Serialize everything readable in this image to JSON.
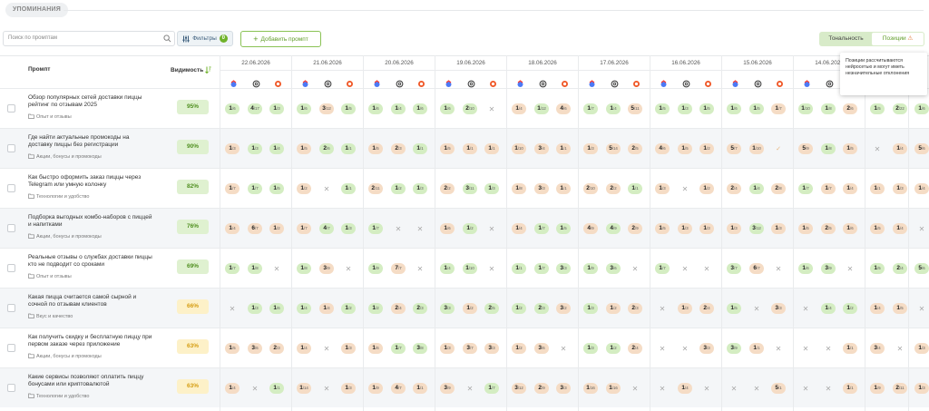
{
  "section": {
    "title": "УПОМИНАНИЯ"
  },
  "search": {
    "placeholder": "Поиск по промптам"
  },
  "filters": {
    "label": "Фильтры",
    "count": "0"
  },
  "add_prompt": {
    "label": "Добавить промпт"
  },
  "toggle": {
    "tonality": "Тональность",
    "positions": "Позиции"
  },
  "tooltip": {
    "text": "Позиции рассчитываются нейросетью и могут иметь незначительные отклонения"
  },
  "table": {
    "col_prompt": "Промпт",
    "col_visibility": "Видимость",
    "dates": [
      "22.06.2026",
      "21.06.2026",
      "20.06.2026",
      "19.06.2026",
      "18.06.2026",
      "17.06.2026",
      "16.06.2026",
      "15.06.2026",
      "14.06.2026"
    ],
    "engines": [
      "yandex-icon",
      "chatgpt-icon",
      "perplexity-icon"
    ],
    "rows": [
      {
        "title": "Обзор популярных сетей доставки пиццы рейтинг по отзывам 2025",
        "category": "Опыт и отзывы",
        "visibility": "95%",
        "tone": "high",
        "cells": [
          [
            "1",
            "/6",
            "g"
          ],
          [
            "4",
            "/17",
            "g"
          ],
          [
            "1",
            "/3",
            "g"
          ],
          [
            "1",
            "/6",
            "g"
          ],
          [
            "3",
            "/12",
            "o"
          ],
          [
            "1",
            "/5",
            "g"
          ],
          [
            "1",
            "/6",
            "g"
          ],
          [
            "1",
            "/4",
            "g"
          ],
          [
            "1",
            "/6",
            "g"
          ],
          [
            "1",
            "/6",
            "g"
          ],
          [
            "2",
            "/10",
            "g"
          ],
          [
            "x"
          ],
          [
            "1",
            "/4",
            "o"
          ],
          [
            "1",
            "/12",
            "g"
          ],
          [
            "4",
            "/6",
            "o"
          ],
          [
            "1",
            "/7",
            "g"
          ],
          [
            "1",
            "/4",
            "g"
          ],
          [
            "5",
            "/11",
            "o"
          ],
          [
            "1",
            "/5",
            "g"
          ],
          [
            "1",
            "/3",
            "g"
          ],
          [
            "1",
            "/5",
            "g"
          ],
          [
            "1",
            "/6",
            "g"
          ],
          [
            "1",
            "/5",
            "g"
          ],
          [
            "1",
            "/7",
            "o"
          ],
          [
            "1",
            "/10",
            "g"
          ],
          [
            "1",
            "/8",
            "g"
          ],
          [
            "2",
            "/6",
            "o"
          ],
          [
            "1",
            "/5",
            "g"
          ],
          [
            "2",
            "/22",
            "g"
          ],
          [
            "1",
            "/6",
            "g"
          ]
        ]
      },
      {
        "title": "Где найти актуальные промокоды на доставку пиццы без регистрации",
        "category": "Акции, бонусы и промокоды",
        "visibility": "90%",
        "tone": "high",
        "cells": [
          [
            "1",
            "/3",
            "o"
          ],
          [
            "1",
            "/3",
            "g"
          ],
          [
            "1",
            "/4",
            "g"
          ],
          [
            "1",
            "/5",
            "o"
          ],
          [
            "2",
            "/6",
            "g"
          ],
          [
            "1",
            "/1",
            "g"
          ],
          [
            "1",
            "/5",
            "o"
          ],
          [
            "2",
            "/3",
            "o"
          ],
          [
            "1",
            "/1",
            "g"
          ],
          [
            "1",
            "/5",
            "o"
          ],
          [
            "1",
            "/1",
            "o"
          ],
          [
            "1",
            "/1",
            "o"
          ],
          [
            "1",
            "/10",
            "o"
          ],
          [
            "3",
            "/4",
            "o"
          ],
          [
            "1",
            "/1",
            "o"
          ],
          [
            "1",
            "/3",
            "o"
          ],
          [
            "5",
            "/14",
            "o"
          ],
          [
            "2",
            "/5",
            "o"
          ],
          [
            "4",
            "/6",
            "o"
          ],
          [
            "1",
            "/5",
            "o"
          ],
          [
            "1",
            "/2",
            "o"
          ],
          [
            "5",
            "/7",
            "o"
          ],
          [
            "1",
            "/10",
            "o"
          ],
          [
            "v"
          ],
          [
            "5",
            "/9",
            "o"
          ],
          [
            "1",
            "/8",
            "g"
          ],
          [
            "1",
            "/5",
            "o"
          ],
          [
            "x"
          ],
          [
            "1",
            "/4",
            "o"
          ],
          [
            "5",
            "/6",
            "o"
          ]
        ]
      },
      {
        "title": "Как быстро оформить заказ пиццы через Telegram или умную колонку",
        "category": "Технологии и удобство",
        "visibility": "82%",
        "tone": "high",
        "cells": [
          [
            "1",
            "/7",
            "o"
          ],
          [
            "1",
            "/7",
            "g"
          ],
          [
            "1",
            "/5",
            "g"
          ],
          [
            "1",
            "/2",
            "o"
          ],
          [
            "x"
          ],
          [
            "1",
            "/1",
            "g"
          ],
          [
            "2",
            "/11",
            "o"
          ],
          [
            "1",
            "/2",
            "g"
          ],
          [
            "1",
            "/3",
            "g"
          ],
          [
            "2",
            "/2",
            "o"
          ],
          [
            "3",
            "/11",
            "g"
          ],
          [
            "1",
            "/3",
            "g"
          ],
          [
            "1",
            "/8",
            "o"
          ],
          [
            "3",
            "/3",
            "o"
          ],
          [
            "1",
            "/1",
            "o"
          ],
          [
            "2",
            "/10",
            "o"
          ],
          [
            "2",
            "/2",
            "o"
          ],
          [
            "1",
            "/1",
            "g"
          ],
          [
            "1",
            "/3",
            "o"
          ],
          [
            "x"
          ],
          [
            "1",
            "/2",
            "o"
          ],
          [
            "2",
            "/4",
            "o"
          ],
          [
            "1",
            "/4",
            "g"
          ],
          [
            "2",
            "/8",
            "o"
          ],
          [
            "1",
            "/7",
            "g"
          ],
          [
            "1",
            "/7",
            "o"
          ],
          [
            "1",
            "/4",
            "o"
          ],
          [
            "1",
            "/1",
            "o"
          ],
          [
            "1",
            "/3",
            "o"
          ],
          [
            "1",
            "/4",
            "o"
          ]
        ]
      },
      {
        "title": "Подборка выгодных комбо-наборов с пиццей и напитками",
        "category": "Акции, бонусы и промокоды",
        "visibility": "76%",
        "tone": "high",
        "cells": [
          [
            "1",
            "/4",
            "o"
          ],
          [
            "6",
            "/7",
            "o"
          ],
          [
            "1",
            "/2",
            "o"
          ],
          [
            "1",
            "/7",
            "o"
          ],
          [
            "4",
            "/7",
            "g"
          ],
          [
            "1",
            "/3",
            "g"
          ],
          [
            "1",
            "/7",
            "g"
          ],
          [
            "x"
          ],
          [
            "x"
          ],
          [
            "1",
            "/6",
            "o"
          ],
          [
            "1",
            "/2",
            "g"
          ],
          [
            "x"
          ],
          [
            "1",
            "/4",
            "o"
          ],
          [
            "1",
            "/7",
            "g"
          ],
          [
            "1",
            "/5",
            "g"
          ],
          [
            "4",
            "/9",
            "o"
          ],
          [
            "4",
            "/9",
            "g"
          ],
          [
            "2",
            "/9",
            "o"
          ],
          [
            "1",
            "/5",
            "o"
          ],
          [
            "1",
            "/3",
            "o"
          ],
          [
            "1",
            "/3",
            "o"
          ],
          [
            "1",
            "/3",
            "o"
          ],
          [
            "3",
            "/12",
            "g"
          ],
          [
            "1",
            "/3",
            "o"
          ],
          [
            "1",
            "/5",
            "o"
          ],
          [
            "2",
            "/5",
            "o"
          ],
          [
            "1",
            "/6",
            "o"
          ],
          [
            "1",
            "/5",
            "o"
          ],
          [
            "1",
            "/4",
            "o"
          ],
          [
            "x"
          ]
        ]
      },
      {
        "title": "Реальные отзывы о службах доставки пиццы кто не подводит со сроками",
        "category": "Опыт и отзывы",
        "visibility": "69%",
        "tone": "high",
        "cells": [
          [
            "1",
            "/7",
            "g"
          ],
          [
            "1",
            "/8",
            "g"
          ],
          [
            "x"
          ],
          [
            "1",
            "/8",
            "g"
          ],
          [
            "3",
            "/9",
            "o"
          ],
          [
            "x"
          ],
          [
            "1",
            "/9",
            "g"
          ],
          [
            "7",
            "/7",
            "o"
          ],
          [
            "x"
          ],
          [
            "1",
            "/4",
            "g"
          ],
          [
            "1",
            "/10",
            "g"
          ],
          [
            "x"
          ],
          [
            "1",
            "/1",
            "g"
          ],
          [
            "1",
            "/7",
            "g"
          ],
          [
            "3",
            "/3",
            "g"
          ],
          [
            "1",
            "/9",
            "g"
          ],
          [
            "3",
            "/6",
            "g"
          ],
          [
            "x"
          ],
          [
            "1",
            "/7",
            "g"
          ],
          [
            "x"
          ],
          [
            "x"
          ],
          [
            "3",
            "/7",
            "g"
          ],
          [
            "6",
            "/7",
            "o"
          ],
          [
            "x"
          ],
          [
            "1",
            "/6",
            "g"
          ],
          [
            "3",
            "/9",
            "g"
          ],
          [
            "x"
          ],
          [
            "1",
            "/5",
            "g"
          ],
          [
            "2",
            "/4",
            "g"
          ],
          [
            "5",
            "/6",
            "g"
          ]
        ]
      },
      {
        "title": "Какая пицца считается самой сырной и сочной по отзывам клиентов",
        "category": "Вкус и качество",
        "visibility": "66%",
        "tone": "mid",
        "cells": [
          [
            "x"
          ],
          [
            "1",
            "/3",
            "g"
          ],
          [
            "1",
            "/6",
            "g"
          ],
          [
            "1",
            "/4",
            "g"
          ],
          [
            "1",
            "/4",
            "o"
          ],
          [
            "1",
            "/2",
            "g"
          ],
          [
            "1",
            "/2",
            "g"
          ],
          [
            "2",
            "/4",
            "o"
          ],
          [
            "2",
            "/3",
            "g"
          ],
          [
            "3",
            "/3",
            "g"
          ],
          [
            "1",
            "/2",
            "o"
          ],
          [
            "2",
            "/5",
            "g"
          ],
          [
            "1",
            "/2",
            "g"
          ],
          [
            "2",
            "/3",
            "g"
          ],
          [
            "3",
            "/2",
            "o"
          ],
          [
            "1",
            "/3",
            "g"
          ],
          [
            "1",
            "/2",
            "o"
          ],
          [
            "2",
            "/3",
            "o"
          ],
          [
            "x"
          ],
          [
            "1",
            "/3",
            "o"
          ],
          [
            "2",
            "/4",
            "o"
          ],
          [
            "1",
            "/5",
            "g"
          ],
          [
            "x"
          ],
          [
            "3",
            "/3",
            "o"
          ],
          [
            "x"
          ],
          [
            "1",
            "/4",
            "g"
          ],
          [
            "1",
            "/2",
            "g"
          ],
          [
            "1",
            "/4",
            "o"
          ],
          [
            "1",
            "/5",
            "o"
          ],
          [
            "x"
          ]
        ]
      },
      {
        "title": "Как получить скидку и бесплатную пиццу при первом заказе через приложение",
        "category": "Акции, бонусы и промокоды",
        "visibility": "63%",
        "tone": "mid",
        "cells": [
          [
            "1",
            "/5",
            "o"
          ],
          [
            "3",
            "/6",
            "o"
          ],
          [
            "2",
            "/3",
            "o"
          ],
          [
            "1",
            "/4",
            "o"
          ],
          [
            "x"
          ],
          [
            "1",
            "/3",
            "o"
          ],
          [
            "1",
            "/6",
            "o"
          ],
          [
            "1",
            "/7",
            "g"
          ],
          [
            "3",
            "/8",
            "g"
          ],
          [
            "1",
            "/3",
            "o"
          ],
          [
            "3",
            "/7",
            "o"
          ],
          [
            "3",
            "/3",
            "o"
          ],
          [
            "1",
            "/2",
            "o"
          ],
          [
            "3",
            "/6",
            "o"
          ],
          [
            "x"
          ],
          [
            "1",
            "/3",
            "g"
          ],
          [
            "1",
            "/2",
            "g"
          ],
          [
            "2",
            "/4",
            "o"
          ],
          [
            "x"
          ],
          [
            "x"
          ],
          [
            "3",
            "/3",
            "o"
          ],
          [
            "3",
            "/9",
            "g"
          ],
          [
            "1",
            "/1",
            "o"
          ],
          [
            "x"
          ],
          [
            "x"
          ],
          [
            "x"
          ],
          [
            "1",
            "/1",
            "o"
          ],
          [
            "3",
            "/4",
            "o"
          ],
          [
            "x"
          ],
          [
            "1",
            "/3",
            "o"
          ]
        ]
      },
      {
        "title": "Какие сервисы позволяют оплатить пиццу бонусами или криптовалютой",
        "category": "Технологии и удобство",
        "visibility": "63%",
        "tone": "mid",
        "cells": [
          [
            "1",
            "/4",
            "o"
          ],
          [
            "x"
          ],
          [
            "1",
            "/1",
            "g"
          ],
          [
            "1",
            "/14",
            "o"
          ],
          [
            "x"
          ],
          [
            "1",
            "/3",
            "o"
          ],
          [
            "1",
            "/9",
            "o"
          ],
          [
            "4",
            "/7",
            "o"
          ],
          [
            "1",
            "/1",
            "o"
          ],
          [
            "3",
            "/9",
            "o"
          ],
          [
            "x"
          ],
          [
            "1",
            "/7",
            "g"
          ],
          [
            "3",
            "/12",
            "o"
          ],
          [
            "2",
            "/9",
            "o"
          ],
          [
            "3",
            "/3",
            "o"
          ],
          [
            "1",
            "/16",
            "o"
          ],
          [
            "1",
            "/16",
            "o"
          ],
          [
            "x"
          ],
          [
            "x"
          ],
          [
            "1",
            "/4",
            "o"
          ],
          [
            "x"
          ],
          [
            "x"
          ],
          [
            "x"
          ],
          [
            "5",
            "/1",
            "o"
          ],
          [
            "x"
          ],
          [
            "x"
          ],
          [
            "1",
            "/1",
            "o"
          ],
          [
            "1",
            "/9",
            "o"
          ],
          [
            "2",
            "/11",
            "o"
          ],
          [
            "1",
            "/3",
            "o"
          ]
        ]
      }
    ]
  }
}
